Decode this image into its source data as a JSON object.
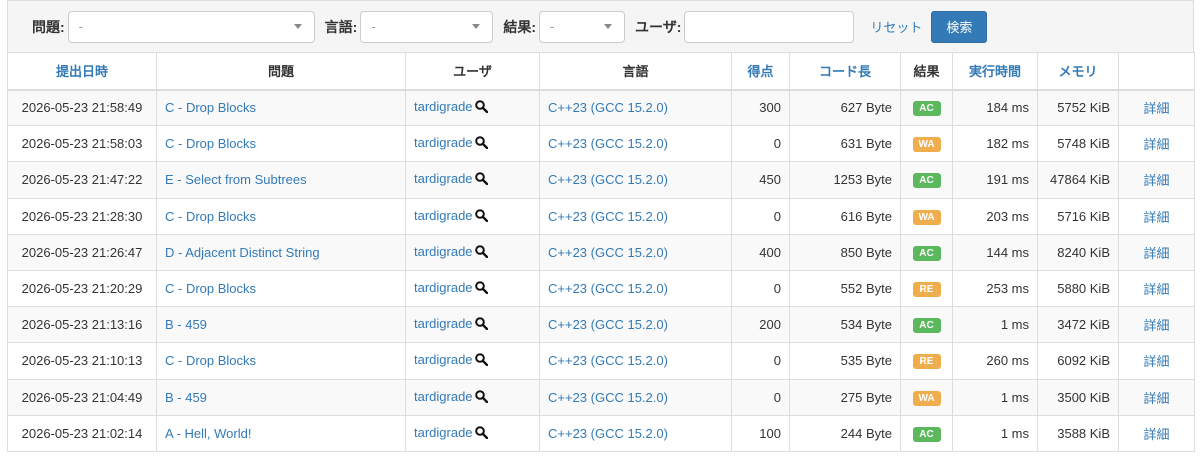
{
  "filter": {
    "problem_label": "問題:",
    "problem_value": "-",
    "language_label": "言語:",
    "language_value": "-",
    "result_label": "結果:",
    "result_value": "-",
    "user_label": "ユーザ:",
    "user_value": "",
    "reset_label": "リセット",
    "search_label": "検索"
  },
  "headers": {
    "date": "提出日時",
    "problem": "問題",
    "user": "ユーザ",
    "language": "言語",
    "score": "得点",
    "code_length": "コード長",
    "result": "結果",
    "time": "実行時間",
    "memory": "メモリ",
    "detail": ""
  },
  "colors": {
    "AC": "#5cb85c",
    "WA": "#f0ad4e",
    "RE": "#f0ad4e",
    "link": "#337ab7"
  },
  "icons": {
    "user_search": "magnifier-icon"
  },
  "rows": [
    {
      "date": "2026-05-23 21:58:49",
      "problem": "C - Drop Blocks",
      "user": "tardigrade",
      "language": "C++23 (GCC 15.2.0)",
      "score": "300",
      "code_length": "627 Byte",
      "result": "AC",
      "time": "184 ms",
      "memory": "5752 KiB",
      "detail": "詳細"
    },
    {
      "date": "2026-05-23 21:58:03",
      "problem": "C - Drop Blocks",
      "user": "tardigrade",
      "language": "C++23 (GCC 15.2.0)",
      "score": "0",
      "code_length": "631 Byte",
      "result": "WA",
      "time": "182 ms",
      "memory": "5748 KiB",
      "detail": "詳細"
    },
    {
      "date": "2026-05-23 21:47:22",
      "problem": "E - Select from Subtrees",
      "user": "tardigrade",
      "language": "C++23 (GCC 15.2.0)",
      "score": "450",
      "code_length": "1253 Byte",
      "result": "AC",
      "time": "191 ms",
      "memory": "47864 KiB",
      "detail": "詳細"
    },
    {
      "date": "2026-05-23 21:28:30",
      "problem": "C - Drop Blocks",
      "user": "tardigrade",
      "language": "C++23 (GCC 15.2.0)",
      "score": "0",
      "code_length": "616 Byte",
      "result": "WA",
      "time": "203 ms",
      "memory": "5716 KiB",
      "detail": "詳細"
    },
    {
      "date": "2026-05-23 21:26:47",
      "problem": "D - Adjacent Distinct String",
      "user": "tardigrade",
      "language": "C++23 (GCC 15.2.0)",
      "score": "400",
      "code_length": "850 Byte",
      "result": "AC",
      "time": "144 ms",
      "memory": "8240 KiB",
      "detail": "詳細"
    },
    {
      "date": "2026-05-23 21:20:29",
      "problem": "C - Drop Blocks",
      "user": "tardigrade",
      "language": "C++23 (GCC 15.2.0)",
      "score": "0",
      "code_length": "552 Byte",
      "result": "RE",
      "time": "253 ms",
      "memory": "5880 KiB",
      "detail": "詳細"
    },
    {
      "date": "2026-05-23 21:13:16",
      "problem": "B - 459",
      "user": "tardigrade",
      "language": "C++23 (GCC 15.2.0)",
      "score": "200",
      "code_length": "534 Byte",
      "result": "AC",
      "time": "1 ms",
      "memory": "3472 KiB",
      "detail": "詳細"
    },
    {
      "date": "2026-05-23 21:10:13",
      "problem": "C - Drop Blocks",
      "user": "tardigrade",
      "language": "C++23 (GCC 15.2.0)",
      "score": "0",
      "code_length": "535 Byte",
      "result": "RE",
      "time": "260 ms",
      "memory": "6092 KiB",
      "detail": "詳細"
    },
    {
      "date": "2026-05-23 21:04:49",
      "problem": "B - 459",
      "user": "tardigrade",
      "language": "C++23 (GCC 15.2.0)",
      "score": "0",
      "code_length": "275 Byte",
      "result": "WA",
      "time": "1 ms",
      "memory": "3500 KiB",
      "detail": "詳細"
    },
    {
      "date": "2026-05-23 21:02:14",
      "problem": "A - Hell, World!",
      "user": "tardigrade",
      "language": "C++23 (GCC 15.2.0)",
      "score": "100",
      "code_length": "244 Byte",
      "result": "AC",
      "time": "1 ms",
      "memory": "3588 KiB",
      "detail": "詳細"
    }
  ]
}
